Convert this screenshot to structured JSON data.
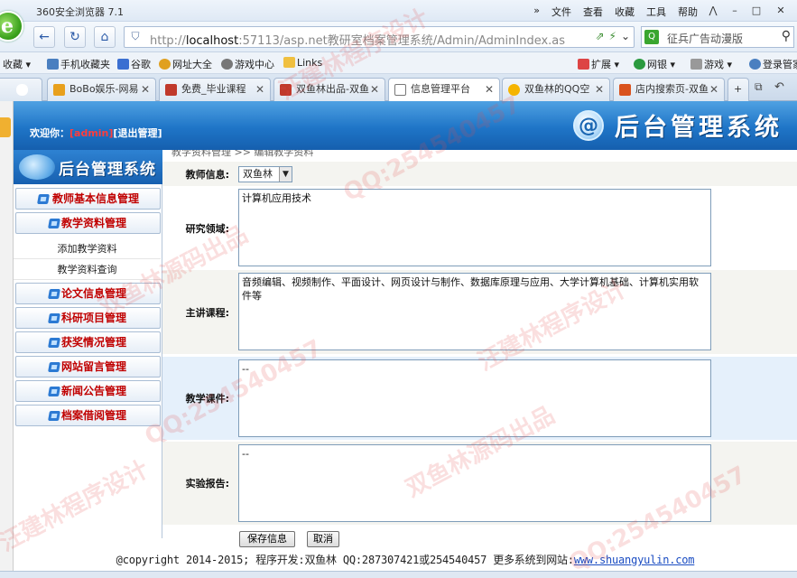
{
  "browser": {
    "title": "360安全浏览器 7.1",
    "menu": [
      "文件",
      "查看",
      "收藏",
      "工具",
      "帮助"
    ],
    "window_controls": [
      "⋀",
      "–",
      "□",
      "✕"
    ],
    "address_prefix": "http://",
    "address_host": "localhost",
    "address_rest": ":57113/asp.net教研室档案管理系统/Admin/AdminIndex.as",
    "search_text": "征兵广告动漫版",
    "favorites": [
      "收藏",
      "手机收藏夹",
      "谷歌",
      "网址大全",
      "游戏中心",
      "Links",
      "扩展",
      "网银",
      "游戏",
      "登录管家"
    ],
    "tabs": [
      {
        "label": "BoBo娱乐-网易",
        "icon_color": "#e8a01c"
      },
      {
        "label": "免费_毕业课程",
        "icon_color": "#c0392b"
      },
      {
        "label": "双鱼林出品-双鱼",
        "icon_color": "#c0392b"
      },
      {
        "label": "信息管理平台",
        "icon_color": "#ffffff",
        "active": true
      },
      {
        "label": "双鱼林的QQ空",
        "icon_color": "#f5b400"
      },
      {
        "label": "店内搜索页-双鱼",
        "icon_color": "#d9531e"
      }
    ]
  },
  "header": {
    "welcome": "欢迎你：",
    "user": "[admin]",
    "logout": "[退出管理]",
    "system_title": "后台管理系统"
  },
  "sidebar": {
    "title": "后台管理系统",
    "items": [
      {
        "label": "教师基本信息管理"
      },
      {
        "label": "教学资料管理"
      },
      {
        "label": "添加教学资料",
        "sub": true
      },
      {
        "label": "教学资料查询",
        "sub": true
      },
      {
        "label": "论文信息管理"
      },
      {
        "label": "科研项目管理"
      },
      {
        "label": "获奖情况管理"
      },
      {
        "label": "网站留言管理"
      },
      {
        "label": "新闻公告管理"
      },
      {
        "label": "档案借阅管理"
      }
    ]
  },
  "form": {
    "breadcrumb": "教学资料管理 >> 编辑教学资料",
    "teacher_label": "教师信息:",
    "teacher_value": "双鱼林",
    "research_label": "研究领域:",
    "research_value": "计算机应用技术",
    "course_label": "主讲课程:",
    "course_value": "音频编辑、视频制作、平面设计、网页设计与制作、数据库原理与应用、大学计算机基础、计算机实用软件等",
    "courseware_label": "教学课件:",
    "courseware_value": "--",
    "report_label": "实验报告:",
    "report_value": "--",
    "save_button": "保存信息",
    "cancel_button": "取消"
  },
  "footer": {
    "text": "@copyright 2014-2015; 程序开发:双鱼林  QQ:287307421或254540457  更多系统到网站:",
    "site": "www.shuangyulin.com"
  },
  "watermarks": [
    "汪建林程序设计",
    "QQ:254540457",
    "双鱼林源码出品",
    "QQ:254540457",
    "汪建林程序设计",
    "双鱼林源码出品",
    "QQ:254540457",
    "汪建林程序设计"
  ]
}
